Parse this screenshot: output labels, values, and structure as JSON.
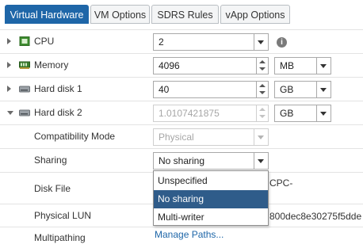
{
  "tabs": [
    {
      "label": "Virtual Hardware",
      "active": true
    },
    {
      "label": "VM Options",
      "active": false
    },
    {
      "label": "SDRS Rules",
      "active": false
    },
    {
      "label": "vApp Options",
      "active": false
    }
  ],
  "rows": {
    "cpu": {
      "label": "CPU",
      "value": "2"
    },
    "memory": {
      "label": "Memory",
      "value": "4096",
      "unit": "MB"
    },
    "hard_disk_1": {
      "label": "Hard disk 1",
      "value": "40",
      "unit": "GB"
    },
    "hard_disk_2": {
      "label": "Hard disk 2",
      "value": "1.0107421875",
      "unit": "GB"
    },
    "compatibility_mode": {
      "label": "Compatibility Mode",
      "value": "Physical"
    },
    "sharing": {
      "label": "Sharing",
      "value": "No sharing"
    },
    "disk_file": {
      "label": "Disk File",
      "value_partial": "CPC-"
    },
    "physical_lun": {
      "label": "Physical LUN",
      "value_partial": "800dec8e30275f5dde"
    },
    "multipathing": {
      "label": "Multipathing",
      "link": "Manage Paths..."
    }
  },
  "sharing_dropdown": {
    "options": [
      "Unspecified",
      "No sharing",
      "Multi-writer"
    ],
    "selected": "No sharing"
  },
  "colors": {
    "accent": "#1e66a8",
    "selected_option": "#2f5c8a"
  }
}
